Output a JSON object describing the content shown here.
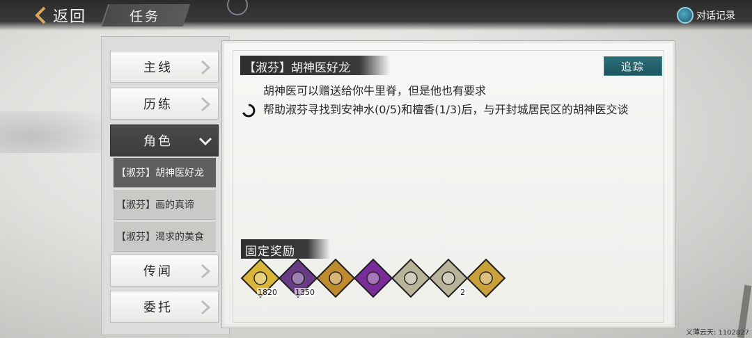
{
  "topbar": {
    "back_label": "返回",
    "title": "任务",
    "dialog_log_label": "对话记录"
  },
  "menu": {
    "items": [
      {
        "label": "主线",
        "active": false
      },
      {
        "label": "历练",
        "active": false
      },
      {
        "label": "角色",
        "active": true
      },
      {
        "label": "传闻",
        "active": false
      },
      {
        "label": "委托",
        "active": false
      }
    ],
    "sub_items": [
      {
        "label": "【淑芬】胡神医好龙",
        "selected": true
      },
      {
        "label": "【淑芬】画的真谛",
        "selected": false
      },
      {
        "label": "【淑芬】渴求的美食",
        "selected": false
      }
    ]
  },
  "quest": {
    "title": "【淑芬】胡神医好龙",
    "track_label": "追踪",
    "description": "胡神医可以赠送给你牛里脊，但是他也有要求",
    "objective": "帮助淑芬寻找到安神水(0/5)和檀香(1/3)后，与开封城居民区的胡神医交谈"
  },
  "rewards": {
    "title": "固定奖励",
    "items": [
      {
        "icon": "gold-coin-icon",
        "count": "1820",
        "color": "#d9b63a"
      },
      {
        "icon": "copper-coin-icon",
        "count": "1350",
        "color": "#6a3c86"
      },
      {
        "icon": "scroll-staff-icon",
        "count": "",
        "color": "#c08a2e"
      },
      {
        "icon": "purple-book-icon",
        "count": "",
        "color": "#7a2c9a"
      },
      {
        "icon": "martial-manual-icon",
        "count": "",
        "color": "#b9b39a"
      },
      {
        "icon": "martial-manual-icon",
        "count": "2",
        "color": "#b9b39a"
      },
      {
        "icon": "beef-tenderloin-icon",
        "count": "",
        "color": "#c9a03a"
      }
    ]
  },
  "footer": {
    "user_text": "义薄云天: 1102827"
  }
}
